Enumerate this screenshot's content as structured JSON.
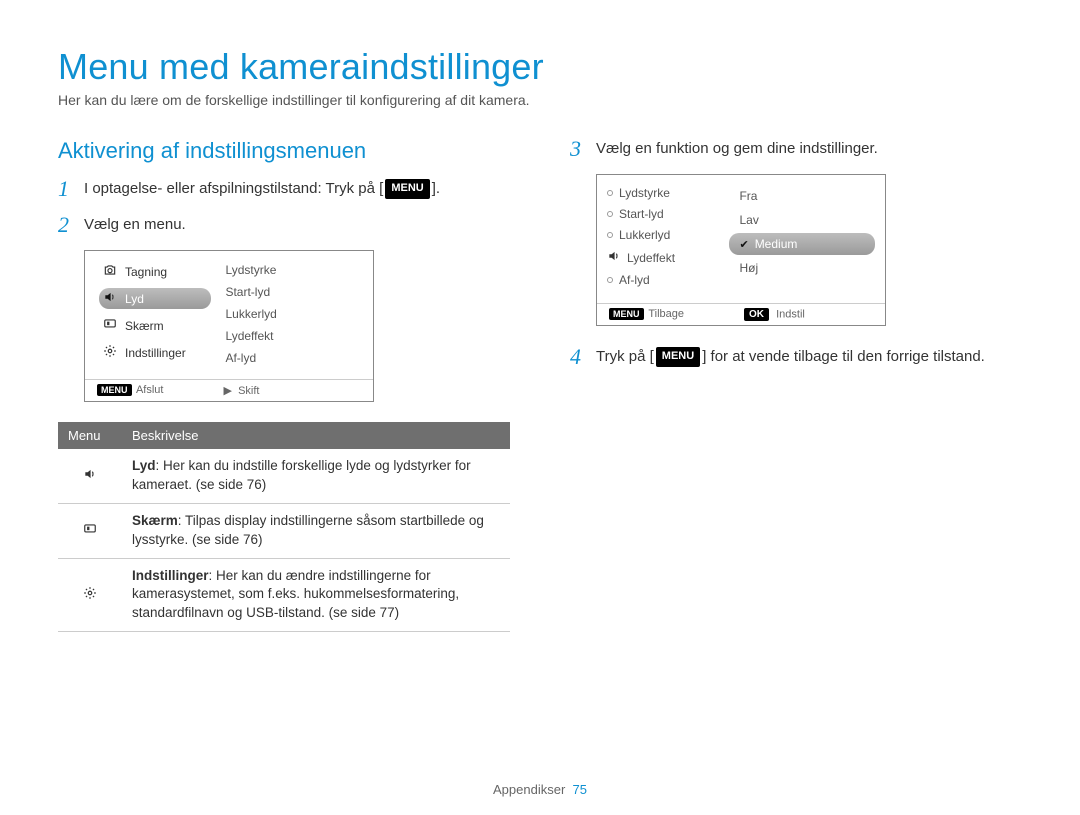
{
  "page": {
    "title": "Menu med kameraindstillinger",
    "intro": "Her kan du lære om de forskellige indstillinger til konfigurering af dit kamera."
  },
  "left": {
    "heading": "Aktivering af indstillingsmenuen",
    "step1_num": "1",
    "step1_pre": "I optagelse- eller afspilningstilstand: Tryk på [",
    "step1_btn": "MENU",
    "step1_post": "].",
    "step2_num": "2",
    "step2": "Vælg en menu."
  },
  "screen1": {
    "left_items": [
      {
        "icon": "camera",
        "label": "Tagning"
      },
      {
        "icon": "sound",
        "label": "Lyd"
      },
      {
        "icon": "screen",
        "label": "Skærm"
      },
      {
        "icon": "gear",
        "label": "Indstillinger"
      }
    ],
    "right_items": [
      "Lydstyrke",
      "Start-lyd",
      "Lukkerlyd",
      "Lydeffekt",
      "Af-lyd"
    ],
    "footer_menu_btn": "MENU",
    "footer_left": "Afslut",
    "footer_right_sym": "▶",
    "footer_right": "Skift"
  },
  "table": {
    "h1": "Menu",
    "h2": "Beskrivelse",
    "rows": [
      {
        "icon": "sound",
        "bold": "Lyd",
        "rest": ": Her kan du indstille forskellige lyde og lydstyrker for kameraet. (se side 76)"
      },
      {
        "icon": "screen",
        "bold": "Skærm",
        "rest": ": Tilpas display indstillingerne såsom startbillede og lysstyrke. (se side 76)"
      },
      {
        "icon": "gear",
        "bold": "Indstillinger",
        "rest": ": Her kan du ændre indstillingerne for kamerasystemet, som f.eks. hukommelsesformatering, standardfilnavn og USB-tilstand. (se side 77)"
      }
    ]
  },
  "right": {
    "step3_num": "3",
    "step3": "Vælg en funktion og gem dine indstillinger.",
    "step4_num": "4",
    "step4_pre": "Tryk på [",
    "step4_btn": "MENU",
    "step4_post": "] for at vende tilbage til den forrige tilstand."
  },
  "screen2": {
    "left_items": [
      "Lydstyrke",
      "Start-lyd",
      "Lukkerlyd",
      "Lydeffekt",
      "Af-lyd"
    ],
    "left_icon_index": 3,
    "options": [
      "Fra",
      "Lav",
      "Medium",
      "Høj"
    ],
    "selected": "Medium",
    "footer_menu_btn": "MENU",
    "footer_left": "Tilbage",
    "footer_ok": "OK",
    "footer_right": "Indstil"
  },
  "footer": {
    "label": "Appendikser",
    "page": "75"
  }
}
